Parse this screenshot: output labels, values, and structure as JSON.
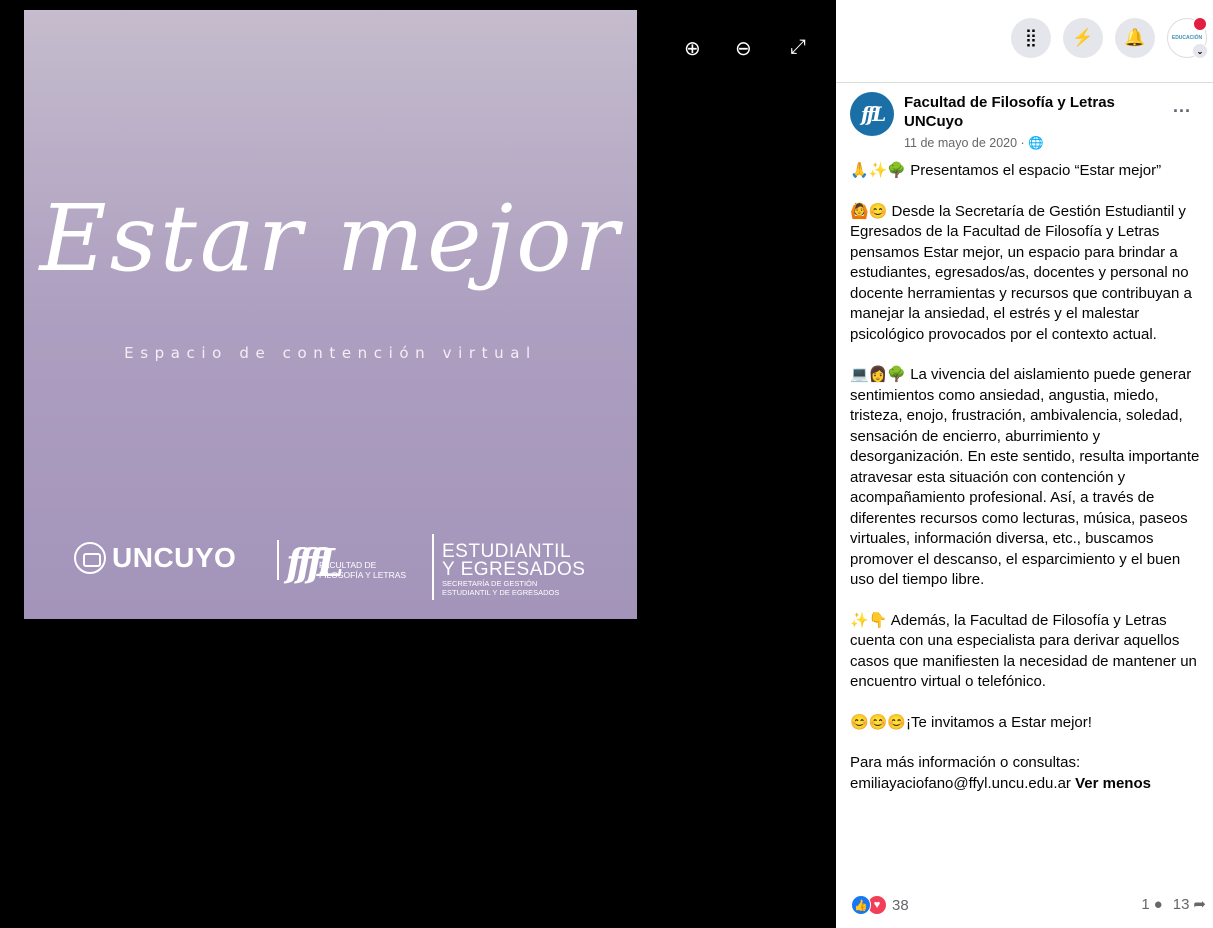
{
  "viewer": {
    "image": {
      "title": "Estar mejor",
      "subtitle": "Espacio de contención virtual",
      "logo_uncuyo": "UNCUYO",
      "logo_ffyl_line1": "FACULTAD DE",
      "logo_ffyl_line2": "FILOSOFÍA Y LETRAS",
      "logo_est_line1": "ESTUDIANTIL",
      "logo_est_line2": "Y EGRESADOS",
      "logo_est_line3": "SECRETARÍA DE GESTIÓN",
      "logo_est_line4": "ESTUDIANTIL Y DE EGRESADOS"
    },
    "controls": {
      "zoom_in_icon": "⊕",
      "zoom_out_icon": "⊖",
      "fullscreen_icon": "⤢"
    }
  },
  "topbar": {
    "menu_icon": "⣿",
    "messenger_icon": "⚡",
    "notifications_icon": "🔔",
    "account_logo_text": "EDUCACIÓN"
  },
  "post": {
    "page_name": "Facultad de Filosofía y Letras UNCuyo",
    "date": "11 de mayo de 2020 · 🌐",
    "more": "...",
    "paragraphs": [
      "🙏✨🌳 Presentamos el espacio “Estar mejor”",
      "🙆😊 Desde la Secretaría de Gestión Estudiantil y Egresados de la Facultad de Filosofía y Letras pensamos Estar mejor, un espacio para brindar a estudiantes, egresados/as, docentes y personal no docente herramientas y recursos que contribuyan a manejar la ansiedad, el estrés y el malestar psicológico provocados por el contexto actual.",
      "💻👩🌳 La vivencia del aislamiento puede generar sentimientos como ansiedad, angustia, miedo, tristeza, enojo, frustración, ambivalencia, soledad, sensación de encierro, aburrimiento y desorganización. En este sentido, resulta importante atravesar esta situación con contención y acompañamiento profesional. Así, a través de diferentes recursos como lecturas, música, paseos virtuales, información diversa, etc., buscamos promover el descanso, el esparcimiento y el buen uso del tiempo libre.",
      "✨👇 Además, la Facultad de Filosofía y Letras cuenta con una especialista para derivar aquellos casos que manifiesten la necesidad de mantener un encuentro virtual o telefónico.",
      "😊😊😊¡Te invitamos a Estar mejor!"
    ],
    "contact_line1": "Para más información o consultas:",
    "contact_email": "emiliayaciofano@ffyl.uncu.edu.ar",
    "see_less": "Ver menos",
    "reaction_count": "38",
    "comment_count": "1",
    "share_count": "13"
  }
}
